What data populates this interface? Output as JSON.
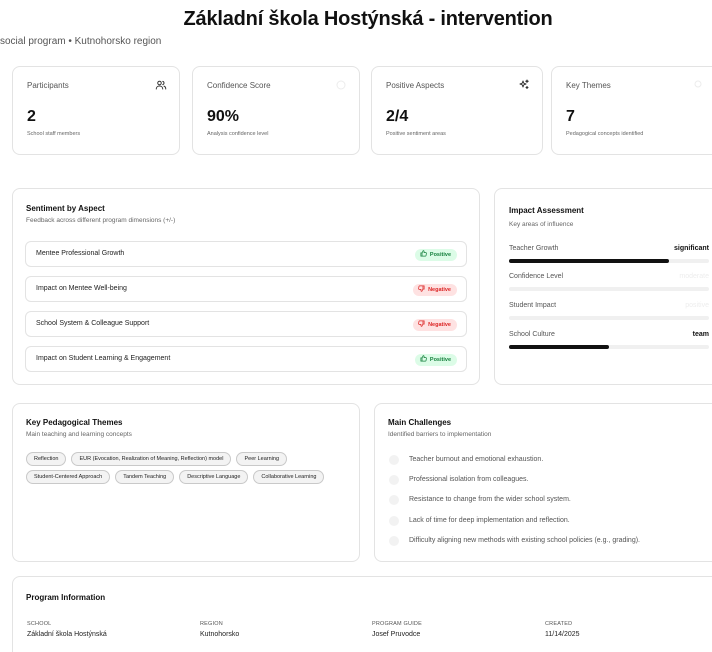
{
  "page": {
    "title": "Základní škola Hostýnská - intervention",
    "subtitle": "social program • Kutnohorsko region"
  },
  "stats": [
    {
      "label": "Participants",
      "value": "2",
      "sub": "School staff members",
      "icon": "users-icon"
    },
    {
      "label": "Confidence Score",
      "value": "90%",
      "sub": "Analysis confidence level",
      "icon": "gauge-icon"
    },
    {
      "label": "Positive Aspects",
      "value": "2/4",
      "sub": "Positive sentiment areas",
      "icon": "sparkles-icon"
    },
    {
      "label": "Key Themes",
      "value": "7",
      "sub": "Pedagogical concepts identified",
      "icon": "lightbulb-icon"
    }
  ],
  "sentiment": {
    "title": "Sentiment by Aspect",
    "subtitle": "Feedback across different program dimensions (+/-)",
    "items": [
      {
        "label": "Mentee Professional Growth",
        "badge": "Positive",
        "sentiment": "positive"
      },
      {
        "label": "Impact on Mentee Well-being",
        "badge": "Negative",
        "sentiment": "negative"
      },
      {
        "label": "School System & Colleague Support",
        "badge": "Negative",
        "sentiment": "negative"
      },
      {
        "label": "Impact on Student Learning & Engagement",
        "badge": "Positive",
        "sentiment": "positive"
      }
    ]
  },
  "impact": {
    "title": "Impact Assessment",
    "subtitle": "Key areas of influence",
    "items": [
      {
        "label": "Teacher Growth",
        "value": "significant",
        "level": 0.8,
        "faint": false
      },
      {
        "label": "Confidence Level",
        "value": "moderate",
        "level": 0.0,
        "faint": true
      },
      {
        "label": "Student Impact",
        "value": "positive",
        "level": 0.0,
        "faint": true
      },
      {
        "label": "School Culture",
        "value": "team",
        "level": 0.5,
        "faint": false
      }
    ]
  },
  "themes": {
    "title": "Key Pedagogical Themes",
    "subtitle": "Main teaching and learning concepts",
    "tags": [
      "Reflection",
      "EUR (Evocation, Realization of Meaning, Reflection) model",
      "Peer Learning",
      "Student-Centered Approach",
      "Tandem Teaching",
      "Descriptive Language",
      "Collaborative Learning"
    ]
  },
  "challenges": {
    "title": "Main Challenges",
    "subtitle": "Identified barriers to implementation",
    "items": [
      "Teacher burnout and emotional exhaustion.",
      "Professional isolation from colleagues.",
      "Resistance to change from the wider school system.",
      "Lack of time for deep implementation and reflection.",
      "Difficulty aligning new methods with existing school policies (e.g., grading)."
    ]
  },
  "info": {
    "title": "Program Information",
    "fields": [
      {
        "label": "SCHOOL",
        "value": "Základní škola Hostýnská"
      },
      {
        "label": "REGION",
        "value": "Kutnohorsko"
      },
      {
        "label": "PROGRAM GUIDE",
        "value": "Josef Pruvodce"
      },
      {
        "label": "CREATED",
        "value": "11/14/2025"
      }
    ]
  },
  "colors": {
    "positive_bg": "#dcfce7",
    "positive_text": "#15803d",
    "negative_bg": "#fee2e2",
    "negative_text": "#dc2626",
    "bar": "#111111",
    "border": "#e3e3e3"
  }
}
